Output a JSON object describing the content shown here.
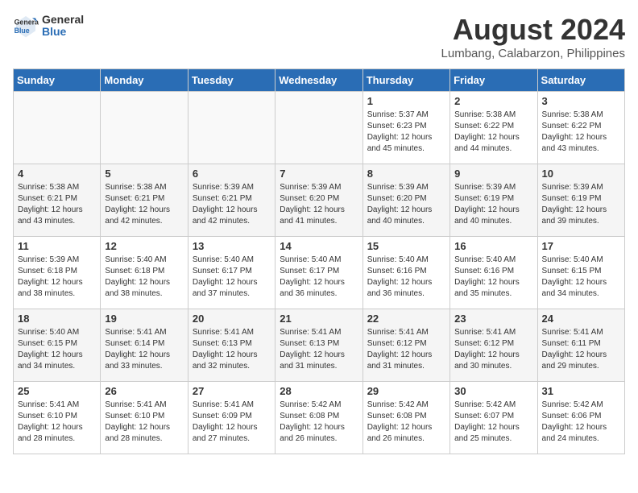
{
  "header": {
    "logo_general": "General",
    "logo_blue": "Blue",
    "month_title": "August 2024",
    "location": "Lumbang, Calabarzon, Philippines"
  },
  "weekdays": [
    "Sunday",
    "Monday",
    "Tuesday",
    "Wednesday",
    "Thursday",
    "Friday",
    "Saturday"
  ],
  "weeks": [
    [
      {
        "day": "",
        "info": ""
      },
      {
        "day": "",
        "info": ""
      },
      {
        "day": "",
        "info": ""
      },
      {
        "day": "",
        "info": ""
      },
      {
        "day": "1",
        "info": "Sunrise: 5:37 AM\nSunset: 6:23 PM\nDaylight: 12 hours\nand 45 minutes."
      },
      {
        "day": "2",
        "info": "Sunrise: 5:38 AM\nSunset: 6:22 PM\nDaylight: 12 hours\nand 44 minutes."
      },
      {
        "day": "3",
        "info": "Sunrise: 5:38 AM\nSunset: 6:22 PM\nDaylight: 12 hours\nand 43 minutes."
      }
    ],
    [
      {
        "day": "4",
        "info": "Sunrise: 5:38 AM\nSunset: 6:21 PM\nDaylight: 12 hours\nand 43 minutes."
      },
      {
        "day": "5",
        "info": "Sunrise: 5:38 AM\nSunset: 6:21 PM\nDaylight: 12 hours\nand 42 minutes."
      },
      {
        "day": "6",
        "info": "Sunrise: 5:39 AM\nSunset: 6:21 PM\nDaylight: 12 hours\nand 42 minutes."
      },
      {
        "day": "7",
        "info": "Sunrise: 5:39 AM\nSunset: 6:20 PM\nDaylight: 12 hours\nand 41 minutes."
      },
      {
        "day": "8",
        "info": "Sunrise: 5:39 AM\nSunset: 6:20 PM\nDaylight: 12 hours\nand 40 minutes."
      },
      {
        "day": "9",
        "info": "Sunrise: 5:39 AM\nSunset: 6:19 PM\nDaylight: 12 hours\nand 40 minutes."
      },
      {
        "day": "10",
        "info": "Sunrise: 5:39 AM\nSunset: 6:19 PM\nDaylight: 12 hours\nand 39 minutes."
      }
    ],
    [
      {
        "day": "11",
        "info": "Sunrise: 5:39 AM\nSunset: 6:18 PM\nDaylight: 12 hours\nand 38 minutes."
      },
      {
        "day": "12",
        "info": "Sunrise: 5:40 AM\nSunset: 6:18 PM\nDaylight: 12 hours\nand 38 minutes."
      },
      {
        "day": "13",
        "info": "Sunrise: 5:40 AM\nSunset: 6:17 PM\nDaylight: 12 hours\nand 37 minutes."
      },
      {
        "day": "14",
        "info": "Sunrise: 5:40 AM\nSunset: 6:17 PM\nDaylight: 12 hours\nand 36 minutes."
      },
      {
        "day": "15",
        "info": "Sunrise: 5:40 AM\nSunset: 6:16 PM\nDaylight: 12 hours\nand 36 minutes."
      },
      {
        "day": "16",
        "info": "Sunrise: 5:40 AM\nSunset: 6:16 PM\nDaylight: 12 hours\nand 35 minutes."
      },
      {
        "day": "17",
        "info": "Sunrise: 5:40 AM\nSunset: 6:15 PM\nDaylight: 12 hours\nand 34 minutes."
      }
    ],
    [
      {
        "day": "18",
        "info": "Sunrise: 5:40 AM\nSunset: 6:15 PM\nDaylight: 12 hours\nand 34 minutes."
      },
      {
        "day": "19",
        "info": "Sunrise: 5:41 AM\nSunset: 6:14 PM\nDaylight: 12 hours\nand 33 minutes."
      },
      {
        "day": "20",
        "info": "Sunrise: 5:41 AM\nSunset: 6:13 PM\nDaylight: 12 hours\nand 32 minutes."
      },
      {
        "day": "21",
        "info": "Sunrise: 5:41 AM\nSunset: 6:13 PM\nDaylight: 12 hours\nand 31 minutes."
      },
      {
        "day": "22",
        "info": "Sunrise: 5:41 AM\nSunset: 6:12 PM\nDaylight: 12 hours\nand 31 minutes."
      },
      {
        "day": "23",
        "info": "Sunrise: 5:41 AM\nSunset: 6:12 PM\nDaylight: 12 hours\nand 30 minutes."
      },
      {
        "day": "24",
        "info": "Sunrise: 5:41 AM\nSunset: 6:11 PM\nDaylight: 12 hours\nand 29 minutes."
      }
    ],
    [
      {
        "day": "25",
        "info": "Sunrise: 5:41 AM\nSunset: 6:10 PM\nDaylight: 12 hours\nand 28 minutes."
      },
      {
        "day": "26",
        "info": "Sunrise: 5:41 AM\nSunset: 6:10 PM\nDaylight: 12 hours\nand 28 minutes."
      },
      {
        "day": "27",
        "info": "Sunrise: 5:41 AM\nSunset: 6:09 PM\nDaylight: 12 hours\nand 27 minutes."
      },
      {
        "day": "28",
        "info": "Sunrise: 5:42 AM\nSunset: 6:08 PM\nDaylight: 12 hours\nand 26 minutes."
      },
      {
        "day": "29",
        "info": "Sunrise: 5:42 AM\nSunset: 6:08 PM\nDaylight: 12 hours\nand 26 minutes."
      },
      {
        "day": "30",
        "info": "Sunrise: 5:42 AM\nSunset: 6:07 PM\nDaylight: 12 hours\nand 25 minutes."
      },
      {
        "day": "31",
        "info": "Sunrise: 5:42 AM\nSunset: 6:06 PM\nDaylight: 12 hours\nand 24 minutes."
      }
    ]
  ]
}
